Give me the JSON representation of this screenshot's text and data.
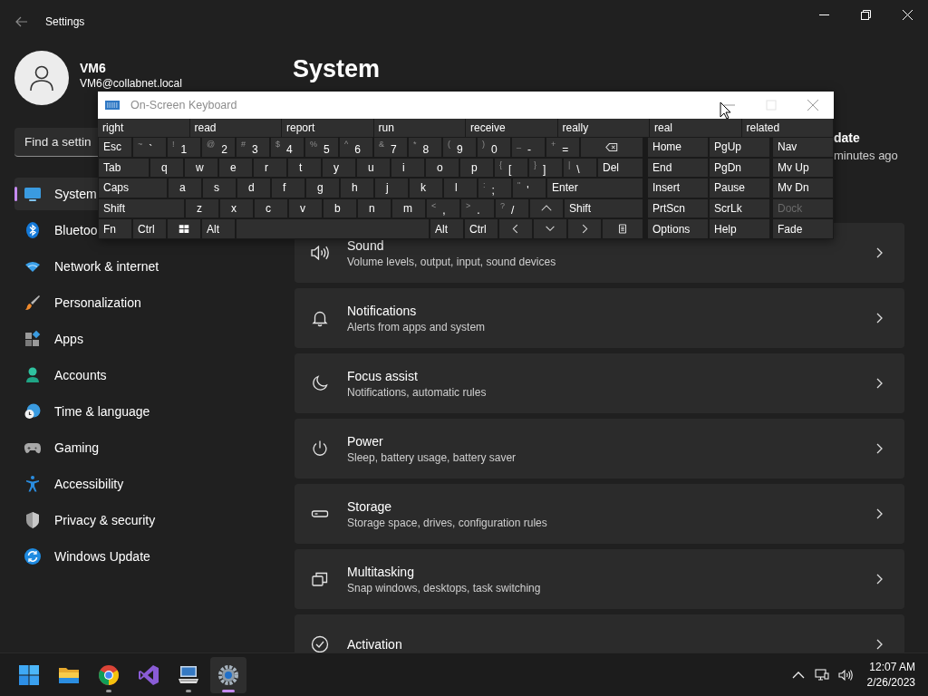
{
  "window": {
    "title": "Settings"
  },
  "profile": {
    "name": "VM6",
    "email": "VM6@collabnet.local"
  },
  "search": {
    "placeholder": "Find a settin"
  },
  "nav": [
    {
      "label": "System",
      "selected": true
    },
    {
      "label": "Bluetoo",
      "selected": false
    },
    {
      "label": "Network & internet",
      "selected": false
    },
    {
      "label": "Personalization",
      "selected": false
    },
    {
      "label": "Apps",
      "selected": false
    },
    {
      "label": "Accounts",
      "selected": false
    },
    {
      "label": "Time & language",
      "selected": false
    },
    {
      "label": "Gaming",
      "selected": false
    },
    {
      "label": "Accessibility",
      "selected": false
    },
    {
      "label": "Privacy & security",
      "selected": false
    },
    {
      "label": "Windows Update",
      "selected": false
    }
  ],
  "page_title": "System",
  "update_status": {
    "title": "date",
    "subtitle": "minutes ago"
  },
  "cards": [
    {
      "title": "Sound",
      "subtitle": "Volume levels, output, input, sound devices"
    },
    {
      "title": "Notifications",
      "subtitle": "Alerts from apps and system"
    },
    {
      "title": "Focus assist",
      "subtitle": "Notifications, automatic rules"
    },
    {
      "title": "Power",
      "subtitle": "Sleep, battery usage, battery saver"
    },
    {
      "title": "Storage",
      "subtitle": "Storage space, drives, configuration rules"
    },
    {
      "title": "Multitasking",
      "subtitle": "Snap windows, desktops, task switching"
    },
    {
      "title": "Activation"
    }
  ],
  "keyboard": {
    "title": "On-Screen Keyboard",
    "predictions": [
      "right",
      "read",
      "report",
      "run",
      "receive",
      "really",
      "real",
      "related"
    ],
    "rows": [
      {
        "keys": [
          {
            "kind": "label",
            "label": "Esc"
          },
          {
            "kind": "dual",
            "shift": "~",
            "main": "`"
          },
          {
            "kind": "dual",
            "shift": "!",
            "main": "1"
          },
          {
            "kind": "dual",
            "shift": "@",
            "main": "2"
          },
          {
            "kind": "dual",
            "shift": "#",
            "main": "3"
          },
          {
            "kind": "dual",
            "shift": "$",
            "main": "4"
          },
          {
            "kind": "dual",
            "shift": "%",
            "main": "5"
          },
          {
            "kind": "dual",
            "shift": "^",
            "main": "6"
          },
          {
            "kind": "dual",
            "shift": "&",
            "main": "7"
          },
          {
            "kind": "dual",
            "shift": "*",
            "main": "8"
          },
          {
            "kind": "dual",
            "shift": "(",
            "main": "9"
          },
          {
            "kind": "dual",
            "shift": ")",
            "main": "0"
          },
          {
            "kind": "dual",
            "shift": "_",
            "main": "-"
          },
          {
            "kind": "dual",
            "shift": "+",
            "main": "="
          },
          {
            "kind": "backspace"
          }
        ]
      },
      {
        "keys": [
          {
            "kind": "label",
            "label": "Tab"
          },
          {
            "kind": "letter",
            "label": "q"
          },
          {
            "kind": "letter",
            "label": "w"
          },
          {
            "kind": "letter",
            "label": "e"
          },
          {
            "kind": "letter",
            "label": "r"
          },
          {
            "kind": "letter",
            "label": "t"
          },
          {
            "kind": "letter",
            "label": "y"
          },
          {
            "kind": "letter",
            "label": "u"
          },
          {
            "kind": "letter",
            "label": "i"
          },
          {
            "kind": "letter",
            "label": "o"
          },
          {
            "kind": "letter",
            "label": "p"
          },
          {
            "kind": "dual",
            "shift": "{",
            "main": "["
          },
          {
            "kind": "dual",
            "shift": "}",
            "main": "]"
          },
          {
            "kind": "dual",
            "shift": "|",
            "main": "\\"
          },
          {
            "kind": "label",
            "label": "Del"
          }
        ]
      },
      {
        "keys": [
          {
            "kind": "label",
            "label": "Caps"
          },
          {
            "kind": "letter",
            "label": "a"
          },
          {
            "kind": "letter",
            "label": "s"
          },
          {
            "kind": "letter",
            "label": "d"
          },
          {
            "kind": "letter",
            "label": "f"
          },
          {
            "kind": "letter",
            "label": "g"
          },
          {
            "kind": "letter",
            "label": "h"
          },
          {
            "kind": "letter",
            "label": "j"
          },
          {
            "kind": "letter",
            "label": "k"
          },
          {
            "kind": "letter",
            "label": "l"
          },
          {
            "kind": "dual",
            "shift": ":",
            "main": ";"
          },
          {
            "kind": "dual",
            "shift": "\"",
            "main": "'"
          },
          {
            "kind": "label",
            "label": "Enter"
          }
        ]
      },
      {
        "keys": [
          {
            "kind": "label",
            "label": "Shift"
          },
          {
            "kind": "letter",
            "label": "z"
          },
          {
            "kind": "letter",
            "label": "x"
          },
          {
            "kind": "letter",
            "label": "c"
          },
          {
            "kind": "letter",
            "label": "v"
          },
          {
            "kind": "letter",
            "label": "b"
          },
          {
            "kind": "letter",
            "label": "n"
          },
          {
            "kind": "letter",
            "label": "m"
          },
          {
            "kind": "dual",
            "shift": "<",
            "main": ","
          },
          {
            "kind": "dual",
            "shift": ">",
            "main": "."
          },
          {
            "kind": "dual",
            "shift": "?",
            "main": "/"
          },
          {
            "kind": "up"
          },
          {
            "kind": "label",
            "label": "Shift"
          }
        ]
      },
      {
        "keys": [
          {
            "kind": "label",
            "label": "Fn"
          },
          {
            "kind": "label",
            "label": "Ctrl"
          },
          {
            "kind": "windows"
          },
          {
            "kind": "label",
            "label": "Alt"
          },
          {
            "kind": "space"
          },
          {
            "kind": "label",
            "label": "Alt"
          },
          {
            "kind": "label",
            "label": "Ctrl"
          },
          {
            "kind": "left"
          },
          {
            "kind": "down"
          },
          {
            "kind": "right"
          },
          {
            "kind": "menu"
          }
        ]
      }
    ],
    "nav_rows": [
      [
        {
          "label": "Home",
          "disabled": false
        },
        {
          "label": "PgUp",
          "disabled": false
        },
        {
          "label": "Nav",
          "disabled": false
        }
      ],
      [
        {
          "label": "End",
          "disabled": false
        },
        {
          "label": "PgDn",
          "disabled": false
        },
        {
          "label": "Mv Up",
          "disabled": false
        }
      ],
      [
        {
          "label": "Insert",
          "disabled": false
        },
        {
          "label": "Pause",
          "disabled": false
        },
        {
          "label": "Mv Dn",
          "disabled": false
        }
      ],
      [
        {
          "label": "PrtScn",
          "disabled": false
        },
        {
          "label": "ScrLk",
          "disabled": false
        },
        {
          "label": "Dock",
          "disabled": true
        }
      ],
      [
        {
          "label": "Options",
          "disabled": false
        },
        {
          "label": "Help",
          "disabled": false
        },
        {
          "label": "Fade",
          "disabled": false
        }
      ]
    ]
  },
  "taskbar": {
    "apps": [
      {
        "running": false,
        "selected": false
      },
      {
        "running": false,
        "selected": false
      },
      {
        "running": true,
        "selected": false
      },
      {
        "running": false,
        "selected": false
      },
      {
        "running": true,
        "selected": false
      },
      {
        "running": true,
        "selected": true
      }
    ],
    "time": "12:07 AM",
    "date": "2/26/2023"
  }
}
